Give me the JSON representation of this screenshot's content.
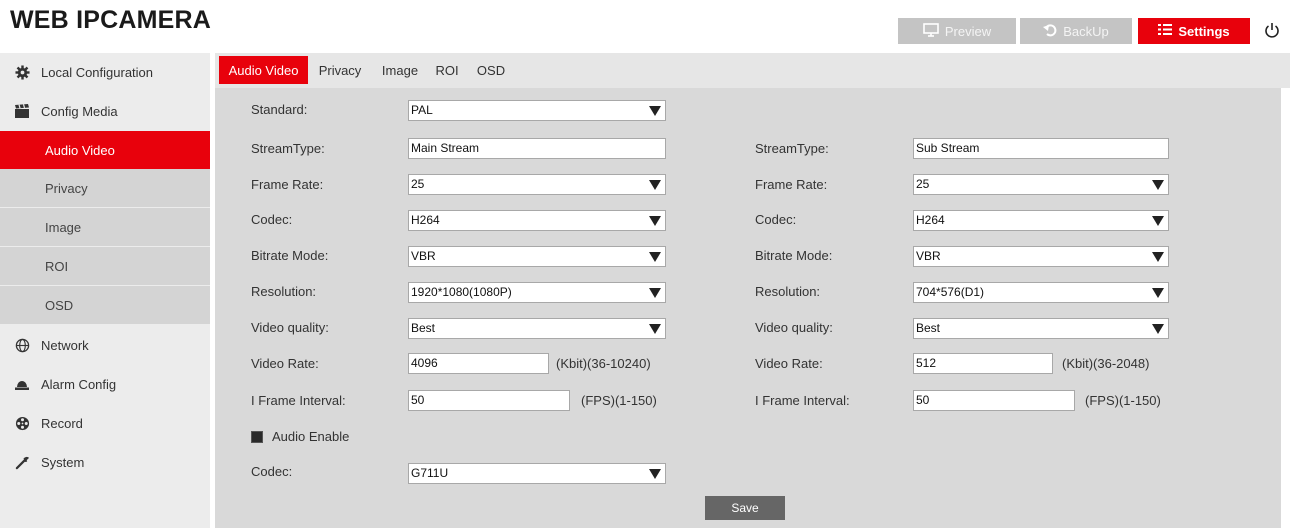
{
  "header": {
    "title": "WEB IPCAMERA",
    "buttons": {
      "preview": "Preview",
      "backup": "BackUp",
      "settings": "Settings"
    }
  },
  "sidebar": {
    "local_configuration": "Local Configuration",
    "config_media": "Config Media",
    "sub_items": [
      "Audio Video",
      "Privacy",
      "Image",
      "ROI",
      "OSD"
    ],
    "network": "Network",
    "alarm_config": "Alarm Config",
    "record": "Record",
    "system": "System"
  },
  "tabs": [
    "Audio Video",
    "Privacy",
    "Image",
    "ROI",
    "OSD"
  ],
  "form": {
    "standard": {
      "label": "Standard:",
      "value": "PAL"
    },
    "main": {
      "stream_type": {
        "label": "StreamType:",
        "value": "Main Stream"
      },
      "frame_rate": {
        "label": "Frame Rate:",
        "value": "25"
      },
      "codec": {
        "label": "Codec:",
        "value": "H264"
      },
      "bitrate_mode": {
        "label": "Bitrate Mode:",
        "value": "VBR"
      },
      "resolution": {
        "label": "Resolution:",
        "value": "1920*1080(1080P)"
      },
      "video_quality": {
        "label": "Video quality:",
        "value": "Best"
      },
      "video_rate": {
        "label": "Video Rate:",
        "value": "4096",
        "hint": "(Kbit)(36-10240)"
      },
      "iframe_interval": {
        "label": "I Frame Interval:",
        "value": "50",
        "hint": "(FPS)(1-150)"
      }
    },
    "sub": {
      "stream_type": {
        "label": "StreamType:",
        "value": "Sub Stream"
      },
      "frame_rate": {
        "label": "Frame Rate:",
        "value": "25"
      },
      "codec": {
        "label": "Codec:",
        "value": "H264"
      },
      "bitrate_mode": {
        "label": "Bitrate Mode:",
        "value": "VBR"
      },
      "resolution": {
        "label": "Resolution:",
        "value": "704*576(D1)"
      },
      "video_quality": {
        "label": "Video quality:",
        "value": "Best"
      },
      "video_rate": {
        "label": "Video Rate:",
        "value": "512",
        "hint": "(Kbit)(36-2048)"
      },
      "iframe_interval": {
        "label": "I Frame Interval:",
        "value": "50",
        "hint": "(FPS)(1-150)"
      }
    },
    "audio_enable": {
      "label": "Audio Enable",
      "checked": true
    },
    "audio_codec": {
      "label": "Codec:",
      "value": "G711U"
    },
    "save": "Save"
  },
  "colors": {
    "accent": "#e8010c",
    "sidebar_bg": "#ececec",
    "content_bg": "#d9d9d9"
  }
}
